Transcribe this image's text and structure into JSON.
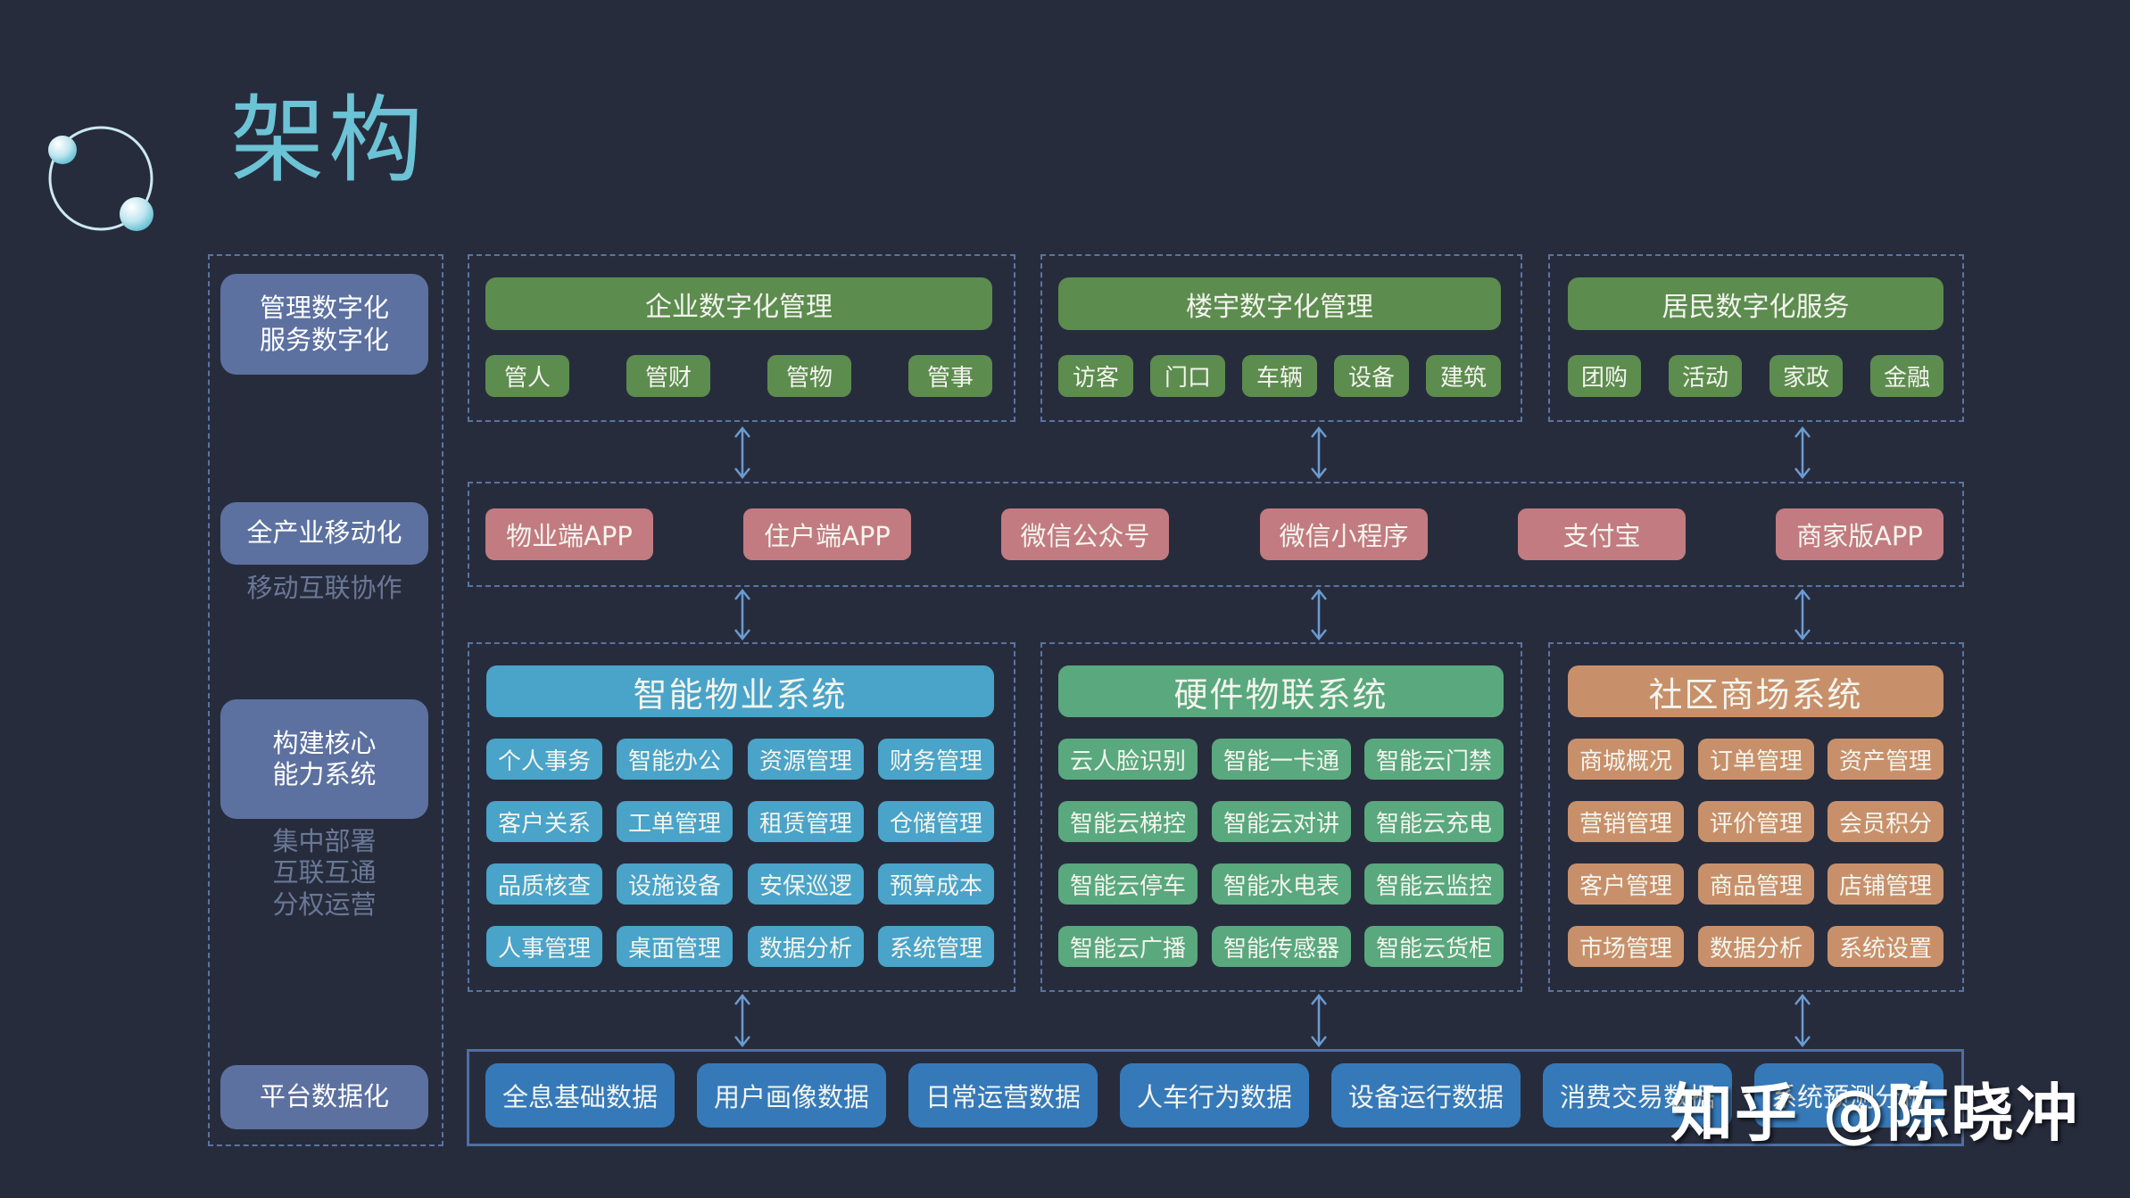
{
  "title": "架构",
  "colors": {
    "background": "#272c3d",
    "title": "#6cc3d5",
    "left_label": "#5c71a0",
    "green": "#5d8c4f",
    "app": "#c27b80",
    "property_system": "#4aa3c8",
    "iot_system": "#5aa87e",
    "mall_system": "#c8906a",
    "data": "#3679b9",
    "dashed_border": "#5a74a0",
    "arrow": "#6b9bd1"
  },
  "left_column": {
    "layers": [
      {
        "label": "管理数字化\n服务数字化",
        "subtitle": ""
      },
      {
        "label": "全产业移动化",
        "subtitle": "移动互联协作"
      },
      {
        "label": "构建核心\n能力系统",
        "subtitle": "集中部署\n互联互通\n分权运营"
      },
      {
        "label": "平台数据化",
        "subtitle": ""
      }
    ]
  },
  "digital_layer": {
    "sections": [
      {
        "title": "企业数字化管理",
        "items": [
          "管人",
          "管财",
          "管物",
          "管事"
        ]
      },
      {
        "title": "楼宇数字化管理",
        "items": [
          "访客",
          "门口",
          "车辆",
          "设备",
          "建筑"
        ]
      },
      {
        "title": "居民数字化服务",
        "items": [
          "团购",
          "活动",
          "家政",
          "金融"
        ]
      }
    ]
  },
  "mobile_layer": {
    "apps": [
      "物业端APP",
      "住户端APP",
      "微信公众号",
      "微信小程序",
      "支付宝",
      "商家版APP"
    ]
  },
  "systems_layer": {
    "systems": [
      {
        "title": "智能物业系统",
        "items": [
          "个人事务",
          "智能办公",
          "资源管理",
          "财务管理",
          "客户关系",
          "工单管理",
          "租赁管理",
          "仓储管理",
          "品质核查",
          "设施设备",
          "安保巡逻",
          "预算成本",
          "人事管理",
          "桌面管理",
          "数据分析",
          "系统管理"
        ]
      },
      {
        "title": "硬件物联系统",
        "items": [
          "云人脸识别",
          "智能一卡通",
          "智能云门禁",
          "智能云梯控",
          "智能云对讲",
          "智能云充电",
          "智能云停车",
          "智能水电表",
          "智能云监控",
          "智能云广播",
          "智能传感器",
          "智能云货柜"
        ]
      },
      {
        "title": "社区商场系统",
        "items": [
          "商城概况",
          "订单管理",
          "资产管理",
          "营销管理",
          "评价管理",
          "会员积分",
          "客户管理",
          "商品管理",
          "店铺管理",
          "市场管理",
          "数据分析",
          "系统设置"
        ]
      }
    ]
  },
  "data_layer": {
    "items": [
      "全息基础数据",
      "用户画像数据",
      "日常运营数据",
      "人车行为数据",
      "设备运行数据",
      "消费交易数据",
      "系统预测分析"
    ]
  },
  "watermark": "知乎 @陈晓冲"
}
